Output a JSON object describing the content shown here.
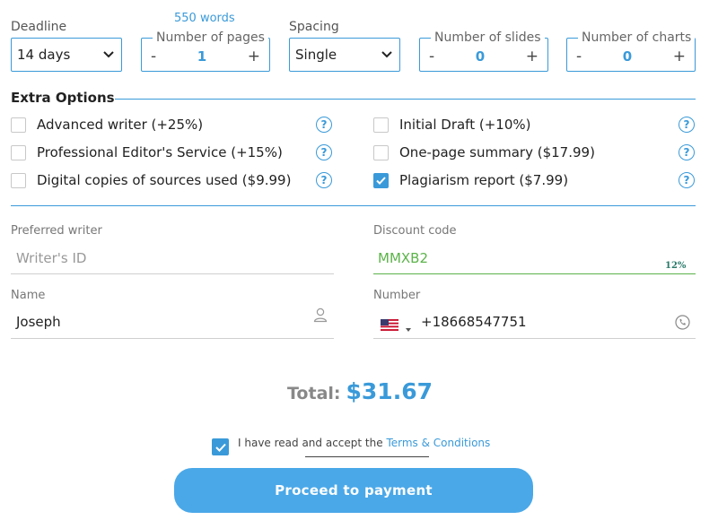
{
  "top": {
    "deadline": {
      "label": "Deadline",
      "value": "14 days"
    },
    "pages": {
      "words": "550 words",
      "label": "Number of pages",
      "minus": "-",
      "value": "1",
      "plus": "+"
    },
    "spacing": {
      "label": "Spacing",
      "value": "Single"
    },
    "slides": {
      "label": "Number of slides",
      "minus": "-",
      "value": "0",
      "plus": "+"
    },
    "charts": {
      "label": "Number of charts",
      "minus": "-",
      "value": "0",
      "plus": "+"
    }
  },
  "extra": {
    "title": "Extra Options",
    "options": [
      {
        "label": "Advanced writer (+25%)",
        "checked": false
      },
      {
        "label": "Professional Editor's Service (+15%)",
        "checked": false
      },
      {
        "label": "Digital copies of sources used ($9.99)",
        "checked": false
      },
      {
        "label": "Initial Draft (+10%)",
        "checked": false
      },
      {
        "label": "One-page summary ($17.99)",
        "checked": false
      },
      {
        "label": "Plagiarism report ($7.99)",
        "checked": true
      }
    ],
    "help": "?"
  },
  "fields": {
    "writer": {
      "label": "Preferred writer",
      "placeholder": "Writer's ID"
    },
    "discount": {
      "label": "Discount code",
      "value": "MMXB2",
      "percent": "12%"
    },
    "name": {
      "label": "Name",
      "value": "Joseph"
    },
    "number": {
      "label": "Number",
      "value": "+18668547751"
    }
  },
  "total": {
    "label": "Total:",
    "value": "$31.67"
  },
  "terms": {
    "prefix": "I have read and accept the",
    "link": "Terms & Conditions",
    "checked": true
  },
  "proceed": {
    "label": "Proceed to payment"
  },
  "colors": {
    "accent": "#3a9ad9",
    "button": "#4aa8e8",
    "success": "#5cb34a"
  }
}
